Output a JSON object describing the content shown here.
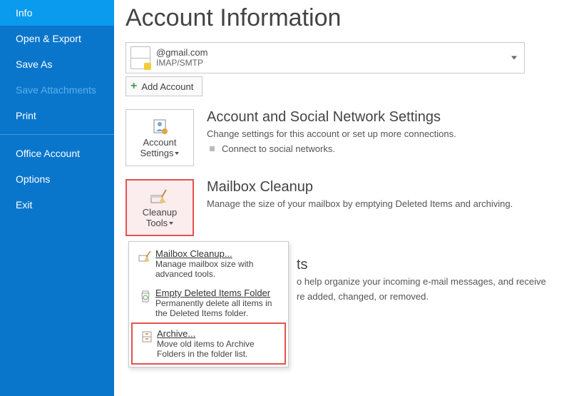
{
  "sidebar": {
    "items": [
      {
        "label": "Info"
      },
      {
        "label": "Open & Export"
      },
      {
        "label": "Save As"
      },
      {
        "label": "Save Attachments"
      },
      {
        "label": "Print"
      },
      {
        "label": "Office Account"
      },
      {
        "label": "Options"
      },
      {
        "label": "Exit"
      }
    ]
  },
  "header": {
    "title": "Account Information"
  },
  "account_selector": {
    "email": "@gmail.com",
    "protocol": "IMAP/SMTP"
  },
  "add_account": {
    "label": "Add Account"
  },
  "account_settings": {
    "button_line1": "Account",
    "button_line2": "Settings",
    "title": "Account and Social Network Settings",
    "desc": "Change settings for this account or set up more connections.",
    "bullet": "Connect to social networks."
  },
  "mailbox_cleanup": {
    "button_line1": "Cleanup",
    "button_line2": "Tools",
    "title": "Mailbox Cleanup",
    "desc": "Manage the size of your mailbox by emptying Deleted Items and archiving."
  },
  "rules_alerts": {
    "title_visible": "ts",
    "desc_line1": "o help organize your incoming e-mail messages, and receive",
    "desc_line2": "re added, changed, or removed."
  },
  "cleanup_menu": {
    "item1": {
      "title": "Mailbox Cleanup...",
      "desc": "Manage mailbox size with advanced tools."
    },
    "item2": {
      "title": "Empty Deleted Items Folder",
      "desc": "Permanently delete all items in the Deleted Items folder."
    },
    "item3": {
      "title": "Archive...",
      "desc": "Move old items to Archive Folders in the folder list."
    }
  },
  "colors": {
    "highlight": "#e4524e",
    "sidebar_bg": "#0976cc"
  }
}
